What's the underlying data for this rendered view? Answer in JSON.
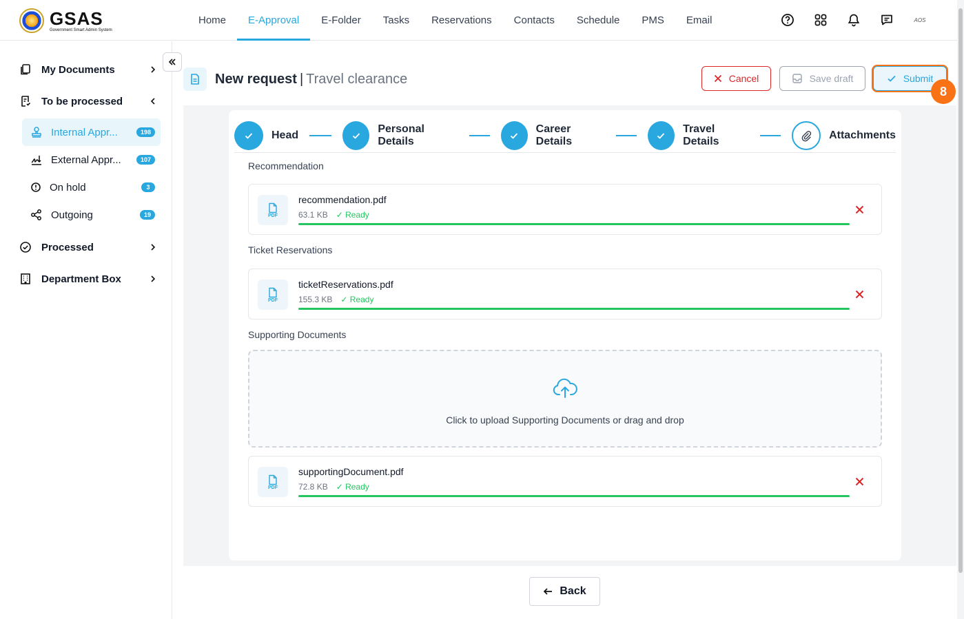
{
  "app": {
    "logo_text": "GSAS",
    "logo_subtitle": "Government Smart Admin System"
  },
  "nav": {
    "items": [
      "Home",
      "E-Approval",
      "E-Folder",
      "Tasks",
      "Reservations",
      "Contacts",
      "Schedule",
      "PMS",
      "Email"
    ],
    "active": "E-Approval"
  },
  "header_icons": [
    "help-icon",
    "apps-grid-icon",
    "bell-icon",
    "chat-icon",
    "user-avatar"
  ],
  "avatar_initials": "AOS",
  "sidebar": {
    "sections": [
      {
        "label": "My Documents",
        "icon": "documents-icon",
        "chevron": "right"
      },
      {
        "label": "To be processed",
        "icon": "to-process-icon",
        "chevron": "left"
      },
      {
        "label": "Processed",
        "icon": "check-circle-icon",
        "chevron": "right"
      },
      {
        "label": "Department Box",
        "icon": "building-icon",
        "chevron": "right"
      }
    ],
    "subitems": [
      {
        "label": "Internal Appr...",
        "badge": "198",
        "icon": "stamp-icon",
        "active": true
      },
      {
        "label": "External Appr...",
        "badge": "107",
        "icon": "signature-icon",
        "active": false
      },
      {
        "label": "On hold",
        "badge": "3",
        "icon": "alert-circle-icon",
        "active": false
      },
      {
        "label": "Outgoing",
        "badge": "19",
        "icon": "share-icon",
        "active": false
      }
    ]
  },
  "page": {
    "title": "New request",
    "separator": "|",
    "subtitle": "Travel clearance"
  },
  "actions": {
    "cancel": "Cancel",
    "save_draft": "Save draft",
    "submit": "Submit",
    "step_marker": "8"
  },
  "stepper": {
    "steps": [
      "Head",
      "Personal Details",
      "Career Details",
      "Travel Details",
      "Attachments"
    ],
    "current": "Attachments"
  },
  "attachments": {
    "recommendation": {
      "title": "Recommendation",
      "file": {
        "name": "recommendation.pdf",
        "size": "63.1 KB",
        "status": "✓ Ready",
        "progress": 1.0
      }
    },
    "tickets": {
      "title": "Ticket Reservations",
      "file": {
        "name": "ticketReservations.pdf",
        "size": "155.3 KB",
        "status": "✓ Ready",
        "progress": 1.0
      }
    },
    "supporting": {
      "title": "Supporting Documents",
      "dropzone": "Click to upload Supporting Documents or drag and drop",
      "file": {
        "name": "supportingDocument.pdf",
        "size": "72.8 KB",
        "status": "✓ Ready",
        "progress": 1.0
      }
    },
    "file_type_label": "PDF"
  },
  "footer": {
    "back": "Back"
  },
  "colors": {
    "accent": "#29a7df",
    "danger": "#dc2626",
    "success": "#22c55e",
    "highlight": "#f97316"
  }
}
